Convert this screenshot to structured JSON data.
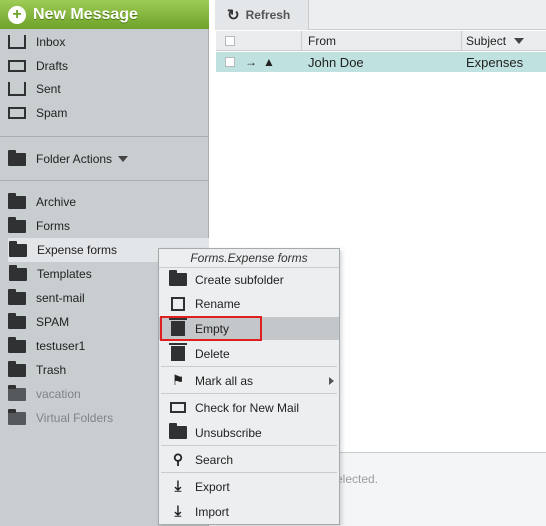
{
  "sidebar": {
    "new_message": "New Message",
    "items_top": [
      {
        "label": "Inbox",
        "icon": "inbox-icon"
      },
      {
        "label": "Drafts",
        "icon": "drafts-icon"
      },
      {
        "label": "Sent",
        "icon": "sent-icon"
      },
      {
        "label": "Spam",
        "icon": "spam-icon"
      }
    ],
    "folder_actions": "Folder Actions",
    "folders": [
      {
        "label": "Archive",
        "icon": "folder-icon"
      },
      {
        "label": "Forms",
        "icon": "folder-open-icon"
      },
      {
        "label": "Expense forms",
        "icon": "folder-icon"
      },
      {
        "label": "Templates",
        "icon": "folder-icon"
      },
      {
        "label": "sent-mail",
        "icon": "folder-icon"
      },
      {
        "label": "SPAM",
        "icon": "folder-icon"
      },
      {
        "label": "testuser1",
        "icon": "folder-icon"
      },
      {
        "label": "Trash",
        "icon": "folder-icon"
      },
      {
        "label": "vacation",
        "icon": "folder-add-icon"
      },
      {
        "label": "Virtual Folders",
        "icon": "folder-add-icon"
      }
    ]
  },
  "toolbar": {
    "refresh": "Refresh"
  },
  "grid": {
    "col_from": "From",
    "col_subject": "Subject",
    "rows": [
      {
        "from": "John Doe",
        "subject": "Expenses"
      }
    ]
  },
  "preview": {
    "text": "elected."
  },
  "context_menu": {
    "title": "Forms.Expense forms",
    "items": [
      {
        "label": "Create subfolder",
        "icon": "create-folder-icon"
      },
      {
        "label": "Rename",
        "icon": "rename-icon"
      },
      {
        "label": "Empty",
        "icon": "empty-trash-icon"
      },
      {
        "label": "Delete",
        "icon": "delete-icon"
      },
      {
        "label": "Mark all as",
        "icon": "flag-icon"
      },
      {
        "label": "Check for New Mail",
        "icon": "mail-icon"
      },
      {
        "label": "Unsubscribe",
        "icon": "folder-icon"
      },
      {
        "label": "Search",
        "icon": "search-icon"
      },
      {
        "label": "Export",
        "icon": "export-icon"
      },
      {
        "label": "Import",
        "icon": "import-icon"
      }
    ]
  },
  "colors": {
    "accent": "#6ea22a",
    "selected_row": "#bfe1e0",
    "highlight_border": "#e02020"
  }
}
